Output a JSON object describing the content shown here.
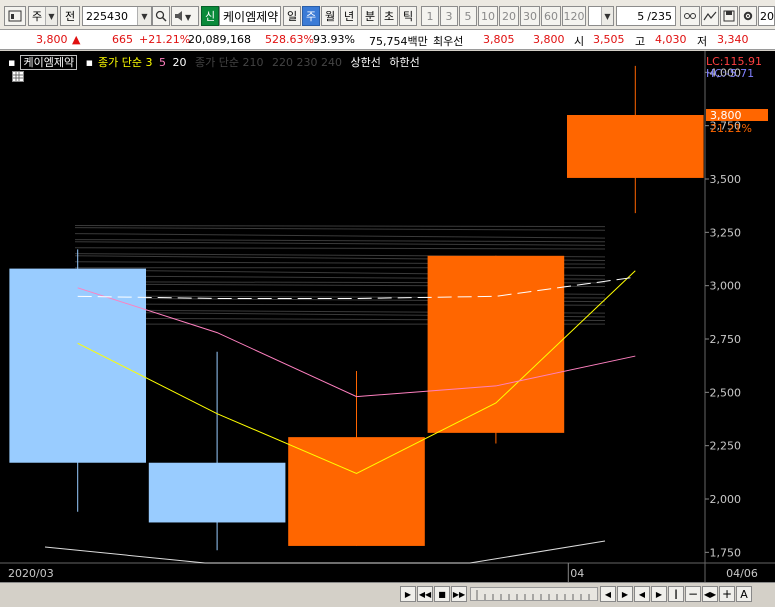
{
  "toolbar": {
    "mode_select": "주",
    "prev_label": "전",
    "stock_code": "225430",
    "quick_label": "신",
    "stock_name": "케이엠제약",
    "period_tabs": [
      "일",
      "주",
      "월",
      "년",
      "분",
      "초",
      "틱"
    ],
    "selected_period": "주",
    "intervals": [
      "1",
      "3",
      "5",
      "10",
      "20",
      "30",
      "60",
      "120"
    ],
    "count_value": "5",
    "count_total": "/235",
    "extra_value": "20"
  },
  "quote": {
    "price": "3,800",
    "arrow": "▲",
    "change": "665",
    "change_pct": "+21.21%",
    "volume": "20,089,168",
    "volume_ratio": "528.63%",
    "turnover": "93.93%",
    "amount": "75,754백만",
    "best_label": "최우선",
    "best_ask": "3,805",
    "best_bid": "3,800",
    "open_label": "시",
    "open_value": "3,505",
    "high_label": "고",
    "high_value": "4,030",
    "low_label": "저",
    "low_value": "3,340"
  },
  "legend": {
    "stock_name": "케이엠제약",
    "ma_label": "종가 단순 3",
    "ma_5": "5",
    "ma_20": "20",
    "ma2_label": "종가 단순 210",
    "ma2_more": "220 230 240",
    "upper_limit": "상한선",
    "lower_limit": "하한선"
  },
  "chart_data": {
    "type": "candlestick",
    "x_labels": [
      "2020/03",
      "04",
      "04/06"
    ],
    "y_ticks": [
      "4,000",
      "3,750",
      "3,500",
      "3,250",
      "3,000",
      "2,750",
      "2,500",
      "2,250",
      "2,000",
      "1,750"
    ],
    "ylim": [
      1700,
      4100
    ],
    "candles": [
      {
        "open": 3080,
        "high": 3170,
        "low": 1940,
        "close": 2170,
        "dir": "down"
      },
      {
        "open": 2170,
        "high": 2690,
        "low": 1760,
        "close": 1890,
        "dir": "down"
      },
      {
        "open": 1780,
        "high": 2600,
        "low": 1780,
        "close": 2290,
        "dir": "up"
      },
      {
        "open": 2310,
        "high": 3140,
        "low": 2260,
        "close": 3140,
        "dir": "up"
      },
      {
        "open": 3505,
        "high": 4030,
        "low": 3340,
        "close": 3800,
        "dir": "up"
      }
    ],
    "series": [
      {
        "name": "3",
        "color": "#ffff00",
        "values": [
          2730,
          2400,
          2120,
          2450,
          3070
        ]
      },
      {
        "name": "5",
        "color": "#ff80c0",
        "values": [
          2990,
          2780,
          2480,
          2530,
          2670
        ]
      },
      {
        "name": "20",
        "color": "#ffffff",
        "values": [
          2950,
          2940,
          2940,
          2950,
          3040
        ]
      }
    ],
    "current_price": "3,800",
    "current_change": "21.21%",
    "lc_label": "LC:115.91",
    "hc_label": "HC:-5.71"
  },
  "colors": {
    "up": "#ff6600",
    "down": "#99ccff",
    "bg": "#000000",
    "axis_text": "#c8c8c8",
    "price_tag": "#ff6600",
    "lc": "#ff4040",
    "hc": "#8080ff"
  }
}
